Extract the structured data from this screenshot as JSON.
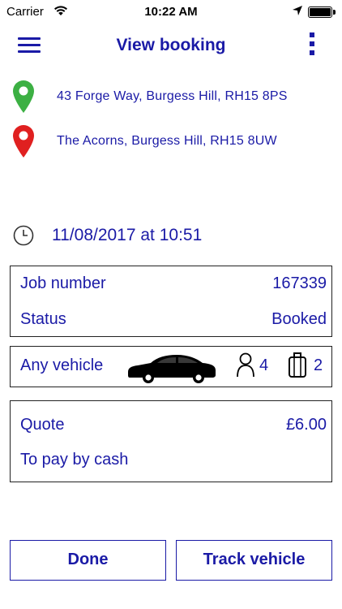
{
  "status_bar": {
    "carrier": "Carrier",
    "time": "10:22 AM",
    "icons": [
      "wifi-icon",
      "location-arrow-icon",
      "battery-icon"
    ]
  },
  "header": {
    "title": "View booking",
    "icons": [
      "hamburger-menu-icon",
      "more-vertical-icon"
    ]
  },
  "route": {
    "pickup": {
      "address": "43 Forge Way, Burgess Hill, RH15 8PS",
      "icon": "map-pin-icon",
      "color": "#3cb043"
    },
    "dropoff": {
      "address": "The Acorns, Burgess Hill, RH15 8UW",
      "icon": "map-pin-icon",
      "color": "#e02020"
    }
  },
  "booking": {
    "datetime": "11/08/2017 at 10:51",
    "job_label": "Job number",
    "job_number": "167339",
    "status_label": "Status",
    "status": "Booked"
  },
  "vehicle": {
    "type": "Any vehicle",
    "passengers": "4",
    "luggage": "2",
    "icons": [
      "car-icon",
      "person-icon",
      "luggage-icon"
    ]
  },
  "payment": {
    "quote_label": "Quote",
    "quote": "£6.00",
    "method": "To pay by cash"
  },
  "actions": {
    "done": "Done",
    "track": "Track vehicle"
  },
  "colors": {
    "accent": "#1a1aa6",
    "border": "#222222",
    "background": "#ffffff"
  }
}
